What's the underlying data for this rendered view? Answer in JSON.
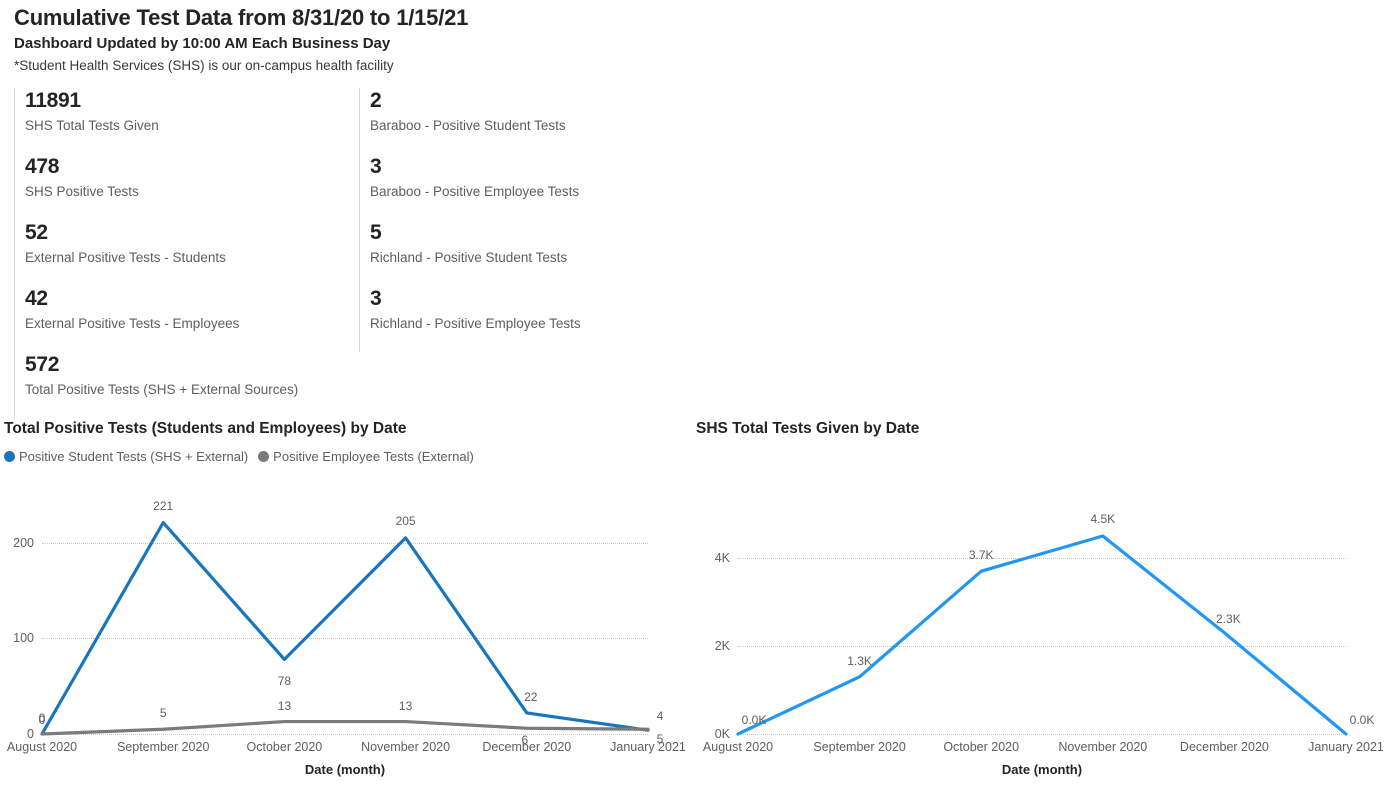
{
  "header": {
    "title": "Cumulative Test Data from 8/31/20 to 1/15/21",
    "subtitle": "Dashboard Updated by 10:00 AM Each Business Day",
    "note": "*Student Health Services (SHS) is our on-campus health facility"
  },
  "kpis": {
    "left_column": [
      {
        "value": "11891",
        "label": "SHS Total Tests Given"
      },
      {
        "value": "478",
        "label": "SHS Positive Tests"
      },
      {
        "value": "52",
        "label": "External Positive Tests - Students"
      },
      {
        "value": "42",
        "label": "External Positive Tests - Employees"
      },
      {
        "value": "572",
        "label": "Total Positive Tests (SHS + External Sources)"
      }
    ],
    "right_column": [
      {
        "value": "2",
        "label": "Baraboo - Positive Student Tests"
      },
      {
        "value": "3",
        "label": "Baraboo - Positive Employee Tests"
      },
      {
        "value": "5",
        "label": "Richland - Positive Student Tests"
      },
      {
        "value": "3",
        "label": "Richland - Positive Employee Tests"
      }
    ]
  },
  "colors": {
    "student_line": "#1A76BC",
    "employee_line": "#7B7B7B",
    "shs_total_line": "#2196F3",
    "gridline": "#c8c6c4",
    "label_text": "#605e5c"
  },
  "chart_data": [
    {
      "type": "line",
      "title": "Total Positive Tests (Students and Employees) by Date",
      "xlabel": "Date (month)",
      "ylabel": "",
      "categories": [
        "August 2020",
        "September 2020",
        "October 2020",
        "November 2020",
        "December 2020",
        "January 2021"
      ],
      "yticks": [
        0,
        100,
        200
      ],
      "ylim": [
        0,
        230
      ],
      "grid": true,
      "legend_position": "top-left",
      "data_labels": true,
      "series": [
        {
          "name": "Positive Student Tests (SHS + External)",
          "color": "#1A76BC",
          "values": [
            0,
            221,
            78,
            205,
            22,
            4
          ],
          "labels": [
            "0",
            "221",
            "78",
            "205",
            "22",
            "4"
          ]
        },
        {
          "name": "Positive Employee Tests (External)",
          "color": "#7B7B7B",
          "values": [
            0,
            5,
            13,
            13,
            6,
            5
          ],
          "labels": [
            "0",
            "5",
            "13",
            "13",
            "6",
            "5"
          ]
        }
      ]
    },
    {
      "type": "line",
      "title": "SHS Total Tests Given by Date",
      "xlabel": "Date (month)",
      "ylabel": "",
      "categories": [
        "August 2020",
        "September 2020",
        "October 2020",
        "November 2020",
        "December 2020",
        "January 2021"
      ],
      "yticks": [
        "0K",
        "2K",
        "4K"
      ],
      "ytick_values": [
        0,
        2000,
        4000
      ],
      "ylim": [
        0,
        5000
      ],
      "grid": true,
      "legend_position": "none",
      "data_labels": true,
      "series": [
        {
          "name": "SHS Total Tests Given",
          "color": "#2196F3",
          "values": [
            0,
            1300,
            3700,
            4500,
            2300,
            0
          ],
          "labels": [
            "0.0K",
            "1.3K",
            "3.7K",
            "4.5K",
            "2.3K",
            "0.0K"
          ]
        }
      ]
    }
  ]
}
